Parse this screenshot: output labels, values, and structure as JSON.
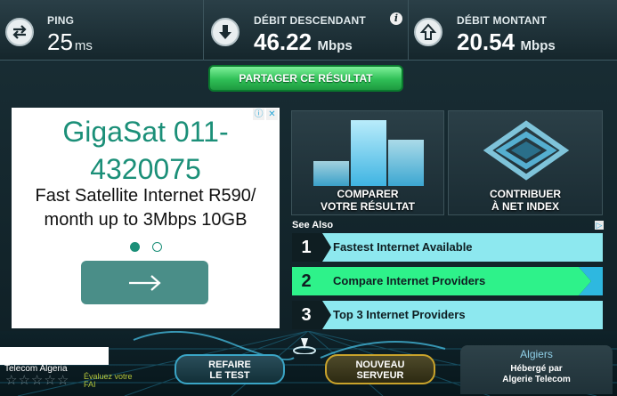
{
  "stats": {
    "ping": {
      "label": "PING",
      "value": "25",
      "unit": "ms",
      "icon": "ping-arrows-icon"
    },
    "download": {
      "label": "DÉBIT DESCENDANT",
      "value": "46.22",
      "unit": "Mbps",
      "icon": "download-arrow-icon"
    },
    "upload": {
      "label": "DÉBIT MONTANT",
      "value": "20.54",
      "unit": "Mbps",
      "icon": "upload-arrow-icon"
    },
    "info_icon": "i"
  },
  "share": {
    "label": "PARTAGER CE RÉSULTAT"
  },
  "ad": {
    "headline_line1": "GigaSat 011-",
    "headline_line2": "4320075",
    "body_line1": "Fast Satellite Internet R590/",
    "body_line2": "month up to 3Mbps 10GB",
    "choices_info": "ⓘ",
    "choices_close": "✕",
    "accent_color": "#1b8f78"
  },
  "tiles": {
    "compare": {
      "line1": "COMPARER",
      "line2": "VOTRE RÉSULTAT"
    },
    "contribute": {
      "line1": "CONTRIBUER",
      "line2": "À NET INDEX"
    }
  },
  "see_also": {
    "title": "See Also",
    "badge": "▷",
    "items": [
      {
        "num": "1",
        "label": "Fastest Internet Available"
      },
      {
        "num": "2",
        "label": "Compare Internet Providers"
      },
      {
        "num": "3",
        "label": "Top 3 Internet Providers"
      }
    ]
  },
  "isp": {
    "name": "Telecom Algeria",
    "rating_stars": [
      "☆",
      "☆",
      "☆",
      "☆",
      "☆"
    ],
    "rate_prompt_line1": "Évaluez votre",
    "rate_prompt_line2": "FAI"
  },
  "buttons": {
    "retest_line1": "REFAIRE",
    "retest_line2": "LE TEST",
    "new_server_line1": "NOUVEAU",
    "new_server_line2": "SERVEUR"
  },
  "server": {
    "city": "Algiers",
    "hosted_by": "Hébergé par",
    "host": "Algerie Telecom"
  },
  "colors": {
    "share_green": "#2fbf56",
    "item_highlight": "#2ef28a",
    "item_cyan": "#8de8ef",
    "retest_border": "#3aa5c6",
    "new_server_border": "#c9a32b"
  }
}
